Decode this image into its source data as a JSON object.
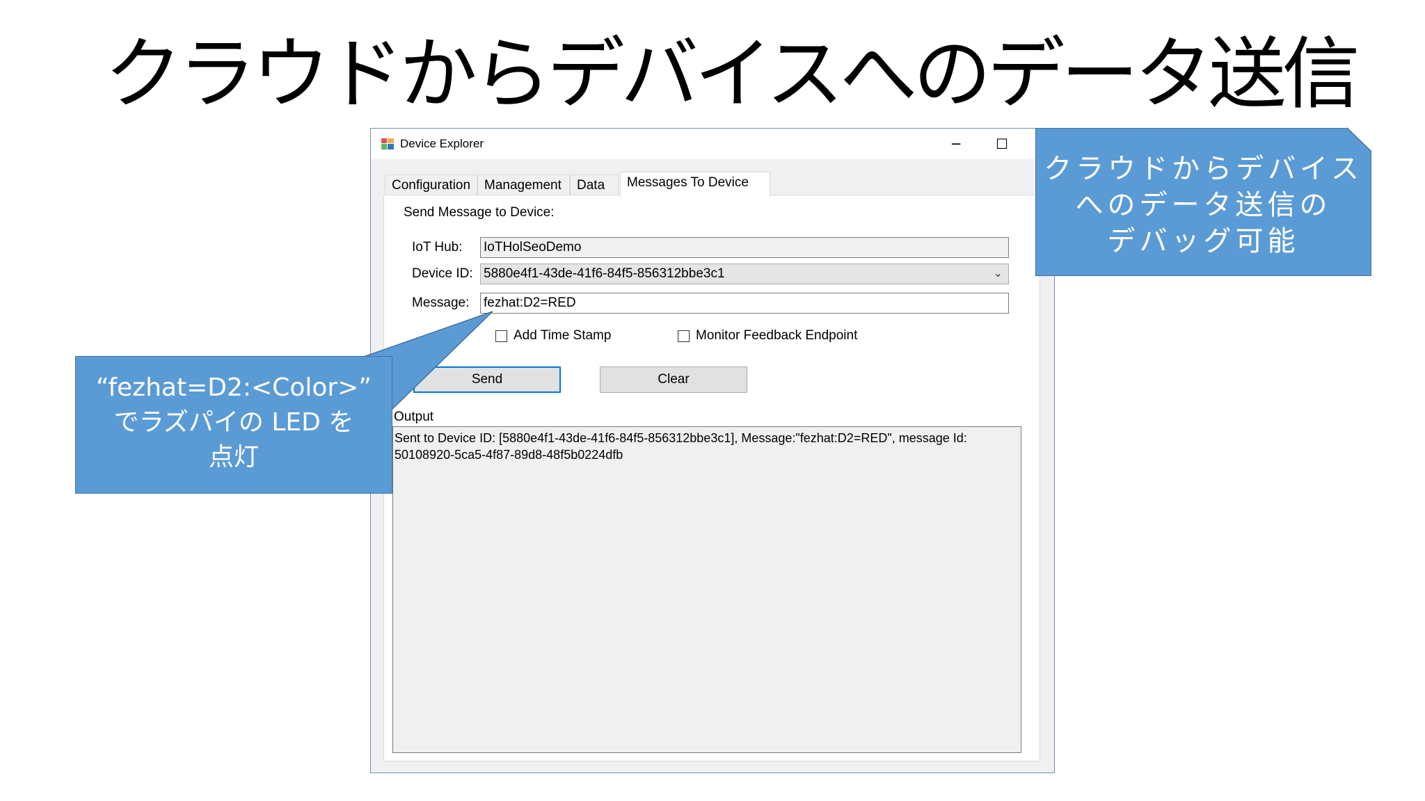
{
  "slide": {
    "title": "クラウドからデバイスへのデータ送信"
  },
  "window": {
    "title": "Device Explorer",
    "minimize_glyph": "─",
    "maximize_glyph": "☐",
    "close_glyph": "✕"
  },
  "tabs": [
    {
      "label": "Configuration",
      "active": false
    },
    {
      "label": "Management",
      "active": false
    },
    {
      "label": "Data",
      "active": false
    },
    {
      "label": "Messages To Device",
      "active": true
    }
  ],
  "form": {
    "section_label": "Send Message to Device:",
    "iot_hub_label": "IoT Hub:",
    "iot_hub_value": "IoTHolSeoDemo",
    "device_id_label": "Device ID:",
    "device_id_value": "5880e4f1-43de-41f6-84f5-856312bbe3c1",
    "message_label": "Message:",
    "message_value": "fezhat:D2=RED",
    "add_timestamp_label": "Add Time Stamp",
    "add_timestamp_checked": false,
    "monitor_feedback_label": "Monitor Feedback Endpoint",
    "monitor_feedback_checked": false,
    "send_label": "Send",
    "clear_label": "Clear",
    "output_label": "Output",
    "output_lines": [
      "Sent to Device ID: [5880e4f1-43de-41f6-84f5-856312bbe3c1], Message:\"fezhat:D2=RED\", message Id:",
      "50108920-5ca5-4f87-89d8-48f5b0224dfb"
    ]
  },
  "callouts": {
    "left_lines": [
      "“fezhat=D2:<Color>”",
      "でラズパイの LED を",
      "点灯"
    ],
    "right_lines": [
      "クラウドからデバイス",
      "へのデータ送信の",
      "デバッグ可能"
    ]
  },
  "colors": {
    "callout_fill": "#5b9bd5",
    "callout_border": "#41719c",
    "focus_border": "#0078d7"
  },
  "icons": {
    "app": "device-explorer-app-icon",
    "dropdown": "chevron-down-icon"
  }
}
